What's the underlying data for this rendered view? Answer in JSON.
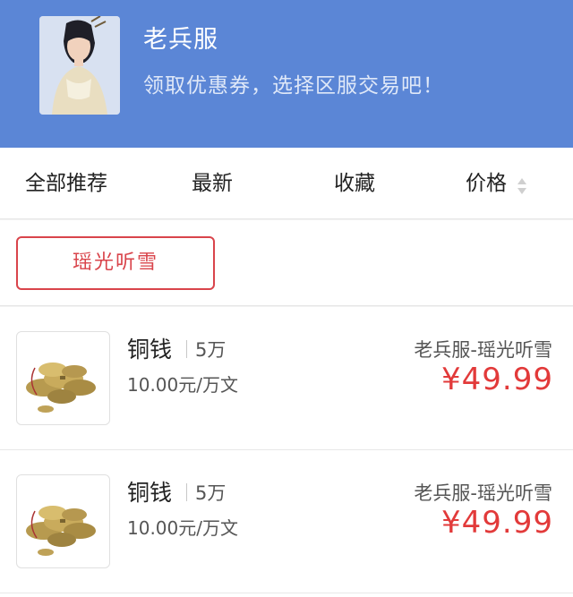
{
  "header": {
    "title": "老兵服",
    "subtitle": "领取优惠券，选择区服交易吧！"
  },
  "tabs": [
    {
      "label": "全部推荐"
    },
    {
      "label": "最新"
    },
    {
      "label": "收藏"
    },
    {
      "label": "价格"
    }
  ],
  "filter": {
    "chip_label": "瑶光听雪"
  },
  "items": [
    {
      "name": "铜钱",
      "quantity": "5万",
      "rate": "10.00元/万文",
      "server": "老兵服-瑶光听雪",
      "price": "¥49.99"
    },
    {
      "name": "铜钱",
      "quantity": "5万",
      "rate": "10.00元/万文",
      "server": "老兵服-瑶光听雪",
      "price": "¥49.99"
    }
  ],
  "colors": {
    "header_bg": "#5b86d6",
    "accent_red": "#e23a3a",
    "chip_border": "#d9444b"
  },
  "icons": {
    "avatar": "character-portrait",
    "sort": "sort-up-down-icon",
    "thumb": "copper-coins-icon"
  }
}
